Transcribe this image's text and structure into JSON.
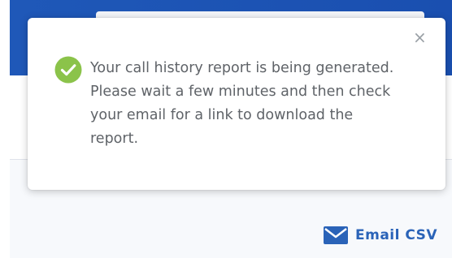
{
  "notification": {
    "message": "Your call history report is being generated. Please wait a few minutes and then check your email for a link to download the report.",
    "close_symbol": "×",
    "icon": "check-circle-icon",
    "icon_color": "#8bc34a"
  },
  "actions": {
    "email_csv_label": "Email CSV",
    "email_csv_icon": "envelope-icon"
  },
  "colors": {
    "header": "#1f58b8",
    "accent_text": "#2a63b8"
  }
}
